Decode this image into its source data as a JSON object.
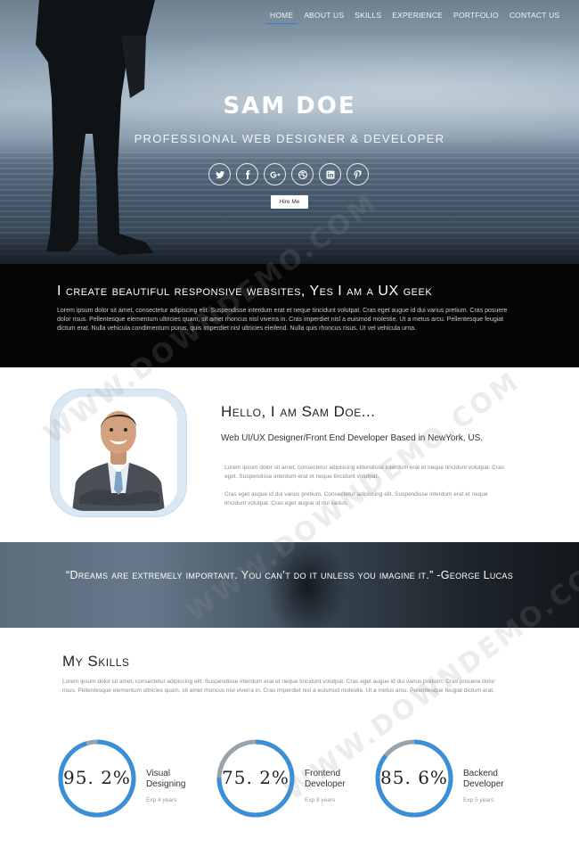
{
  "nav": {
    "items": [
      {
        "label": "HOME",
        "active": true
      },
      {
        "label": "ABOUT US",
        "active": false
      },
      {
        "label": "SKILLS",
        "active": false
      },
      {
        "label": "EXPERIENCE",
        "active": false
      },
      {
        "label": "PORTFOLIO",
        "active": false
      },
      {
        "label": "CONTACT US",
        "active": false
      }
    ]
  },
  "hero": {
    "name": "SAM DOE",
    "subtitle": "PROFESSIONAL WEB DESIGNER & DEVELOPER",
    "social_icons": [
      "twitter-icon",
      "facebook-icon",
      "google-plus-icon",
      "dribbble-icon",
      "linkedin-icon",
      "pinterest-icon"
    ],
    "hire_label": "Hire Me"
  },
  "band": {
    "heading": "I create beautiful responsive websites, Yes I am a UX geek",
    "text": "Lorem ipsum dolor sit amet, consectetur adipiscing elit. Suspendisse interdum erat et neque tincidunt volutpat. Cras eget augue id dui varius pretium. Cras posuere dolor risus. Pellentesque elementum ultricies quam, sit amet rhoncus nisl viverra in. Cras imperdiet nisl a euismod molestie. Ut a metus arcu. Pellentesque feugiat dictum erat. Nulla vehicula condimentum purus, quis imperdiet nisl ultricies eleifend. Nulla quis rhoncus risus. Ut vel vehicula urna."
  },
  "about": {
    "heading": "Hello, I am Sam Doe...",
    "tagline": "Web UI/UX Designer/Front End Developer Based in NewYork, US.",
    "para1": "Lorem ipsum dolor sit amet, consectetur adipiscing elitendisse interdum erat et neque tincidunt volutpat. Cras eget. Suspendisse interdum erat et neque tincidunt volutpat.",
    "para2": "Cras eget augue id dui varius pretium. Consectetur adipiscing elit. Suspendisse interdum erat et neque tincidunt volutpat. Cras eget augue id dui varius."
  },
  "quote": {
    "text": "“Dreams are extremely important. You can’t do it unless you imagine it.” -George Lucas"
  },
  "skills": {
    "heading": "My Skills",
    "intro": "Lorem ipsum dolor sit amet, consectetur adipiscing elit. Suspendisse interdum erat et neque tincidunt volutpat. Cras eget augue id dui varius pretium. Cras posuere dolor risus. Pellentesque elementum ultricies quam, sit amet rhoncus nisl viverra in. Cras imperdiet nisl a euismod molestie. Ut a metus arcu. Pellentesque feugiat dictum erat.",
    "items": [
      {
        "percent_label": "95. 2%",
        "value": 95.2,
        "name": "Visual Designing",
        "exp": "Exp 4 years"
      },
      {
        "percent_label": "75. 2%",
        "value": 75.2,
        "name": "Frontend Developer",
        "exp": "Exp 8 years"
      },
      {
        "percent_label": "85. 6%",
        "value": 85.6,
        "name": "Backend Developer",
        "exp": "Exp 5 years"
      }
    ],
    "ring_color": "#3a8fd6",
    "ring_track_color": "#9aa3aa"
  },
  "watermark": "WWW.DOWNDEMO.COM"
}
